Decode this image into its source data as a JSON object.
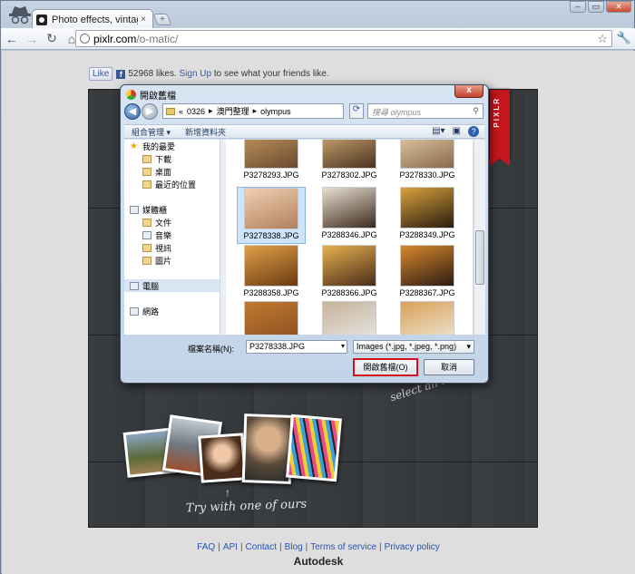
{
  "browser": {
    "tab_title": "Photo effects, vintage, retr",
    "tab_close": "×",
    "new_tab": "+",
    "url_domain": "pixlr.com",
    "url_path": "/o-matic/",
    "window_controls": [
      "–",
      "▭",
      "✕"
    ]
  },
  "page": {
    "fb_like_label": "Like",
    "fb_likes_text": "52968 likes.",
    "fb_signup_link": "Sign Up",
    "fb_suffix": "to see what your friends like.",
    "ribbon_text": "PIXLR",
    "select_hint": "select an image",
    "try_text": "Try with one of ours",
    "footer_links": [
      "FAQ",
      "API",
      "Contact",
      "Blog",
      "Terms of service",
      "Privacy policy"
    ],
    "brand": "Autodesk"
  },
  "dialog": {
    "title": "開啟舊檔",
    "close": "x",
    "breadcrumb": [
      "«",
      "0326",
      "▸",
      "澳門整理",
      "▸",
      "olympus"
    ],
    "search_placeholder": "搜尋 olympus",
    "cmd_organize": "組合管理 ▾",
    "cmd_new_folder": "新增資料夾",
    "nav": [
      {
        "label": "我的最愛",
        "sub": false,
        "icon": "star-icon"
      },
      {
        "label": "下載",
        "sub": true,
        "icon": "folder-icon"
      },
      {
        "label": "桌面",
        "sub": true,
        "icon": "folder-icon"
      },
      {
        "label": "最近的位置",
        "sub": true,
        "icon": "folder-icon"
      },
      {
        "label": "",
        "sub": false,
        "icon": ""
      },
      {
        "label": "媒體櫃",
        "sub": false,
        "icon": "library-icon"
      },
      {
        "label": "文件",
        "sub": true,
        "icon": "folder-icon"
      },
      {
        "label": "音樂",
        "sub": true,
        "icon": "music-icon"
      },
      {
        "label": "視訊",
        "sub": true,
        "icon": "folder-icon"
      },
      {
        "label": "圖片",
        "sub": true,
        "icon": "folder-icon"
      },
      {
        "label": "",
        "sub": false,
        "icon": ""
      },
      {
        "label": "電腦",
        "sub": false,
        "icon": "computer-icon"
      },
      {
        "label": "",
        "sub": false,
        "icon": ""
      },
      {
        "label": "網路",
        "sub": false,
        "icon": "network-icon"
      }
    ],
    "files": [
      {
        "name": "P3278293.JPG",
        "color": "#6b4a2e",
        "color2": "#c79b62"
      },
      {
        "name": "P3278302.JPG",
        "color": "#4a3220",
        "color2": "#d9b27a"
      },
      {
        "name": "P3278330.JPG",
        "color": "#8a6a4a",
        "color2": "#e8d3b1"
      },
      {
        "name": "P3278338.JPG",
        "color": "#b08060",
        "color2": "#f0d0b0"
      },
      {
        "name": "P3288346.JPG",
        "color": "#3e2a1c",
        "color2": "#e8e0d2"
      },
      {
        "name": "P3288349.JPG",
        "color": "#2a1c10",
        "color2": "#d8a23c"
      },
      {
        "name": "P3288358.JPG",
        "color": "#6b3a12",
        "color2": "#e0a048"
      },
      {
        "name": "P3288366.JPG",
        "color": "#4a2c18",
        "color2": "#e6b050"
      },
      {
        "name": "P3288367.JPG",
        "color": "#2c1c12",
        "color2": "#d8882e"
      },
      {
        "name": "",
        "color": "#8a5020",
        "color2": "#c07830"
      },
      {
        "name": "",
        "color": "#e8e8e4",
        "color2": "#c6b29a"
      },
      {
        "name": "",
        "color": "#f0e6d6",
        "color2": "#d8a058"
      }
    ],
    "filename_label": "檔案名稱(N):",
    "filename_value": "P3278338.JPG",
    "filetype_value": "Images (*.jpg, *.jpeg, *.png)",
    "open_label": "開啟舊檔(O)",
    "cancel_label": "取消"
  }
}
